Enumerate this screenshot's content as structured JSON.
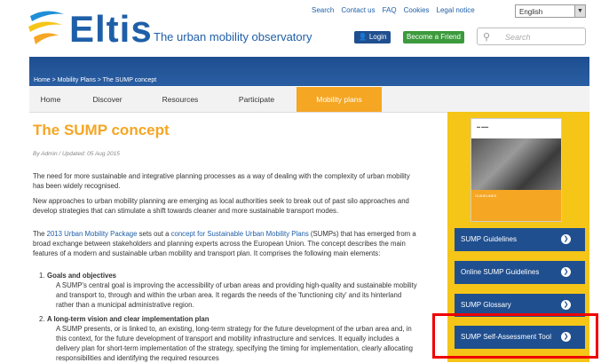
{
  "header": {
    "logo_text": "Eltis",
    "tagline": "The urban mobility observatory",
    "top_links": [
      "Search",
      "Contact us",
      "FAQ",
      "Cookies",
      "Legal notice"
    ],
    "language": "English",
    "login_label": "Login",
    "friend_label": "Become a Friend",
    "search_placeholder": "Search"
  },
  "breadcrumb": "Home > Mobility Plans > The SUMP concept",
  "nav": {
    "items": [
      "Home",
      "Discover",
      "Resources",
      "Participate",
      "Mobility plans"
    ],
    "active_index": 4
  },
  "article": {
    "title": "The SUMP concept",
    "byline": "By Admin / Updated: 05 Aug 2015",
    "p1": "The need for more sustainable and integrative planning processes as a way of dealing with the complexity of urban mobility has been widely recognised.",
    "p2": "New approaches to urban mobility planning are emerging as local authorities seek to break out of past silo approaches and develop strategies that can stimulate a shift towards cleaner and more sustainable transport modes.",
    "p3_pre": "The ",
    "p3_link1": "2013 Urban Mobility Package",
    "p3_mid": " sets out a ",
    "p3_link2": "concept for Sustainable Urban Mobility Plans",
    "p3_post": " (SUMPs) that has emerged from a broad exchange between stakeholders and planning experts across the European Union. The concept describes the main features of a modern and sustainable urban mobility and transport plan. It comprises the following main elements:",
    "items": [
      {
        "num": "1.",
        "heading": "Goals and objectives",
        "body": "A SUMP's central goal is improving the accessibility of urban areas and providing high-quality and sustainable mobility and transport to, through and within the urban area. It regards the needs of the 'functioning city' and its hinterland rather than a municipal administrative region."
      },
      {
        "num": "2.",
        "heading": "A long-term vision and clear implementation plan",
        "body": "A SUMP presents, or is linked to, an existing, long-term strategy for the future development of the urban area and, in this context, for the future development of transport and mobility infrastructure and services. It equally includes a delivery plan for short-term implementation of the strategy, specifying the timing for implementation, clearly allocating responsibilities and identifying the required resources"
      }
    ]
  },
  "sidebar": {
    "cover_label": "GUIDELINES",
    "buttons": [
      "SUMP Guidelines",
      "Online SUMP Guidelines",
      "SUMP Glossary",
      "SUMP Self-Assessment Tool"
    ]
  },
  "colors": {
    "brand_blue": "#1f5fa8",
    "accent_orange": "#f5a623",
    "sidebar_yellow": "#f5c518",
    "highlight_red": "#ee0000"
  }
}
